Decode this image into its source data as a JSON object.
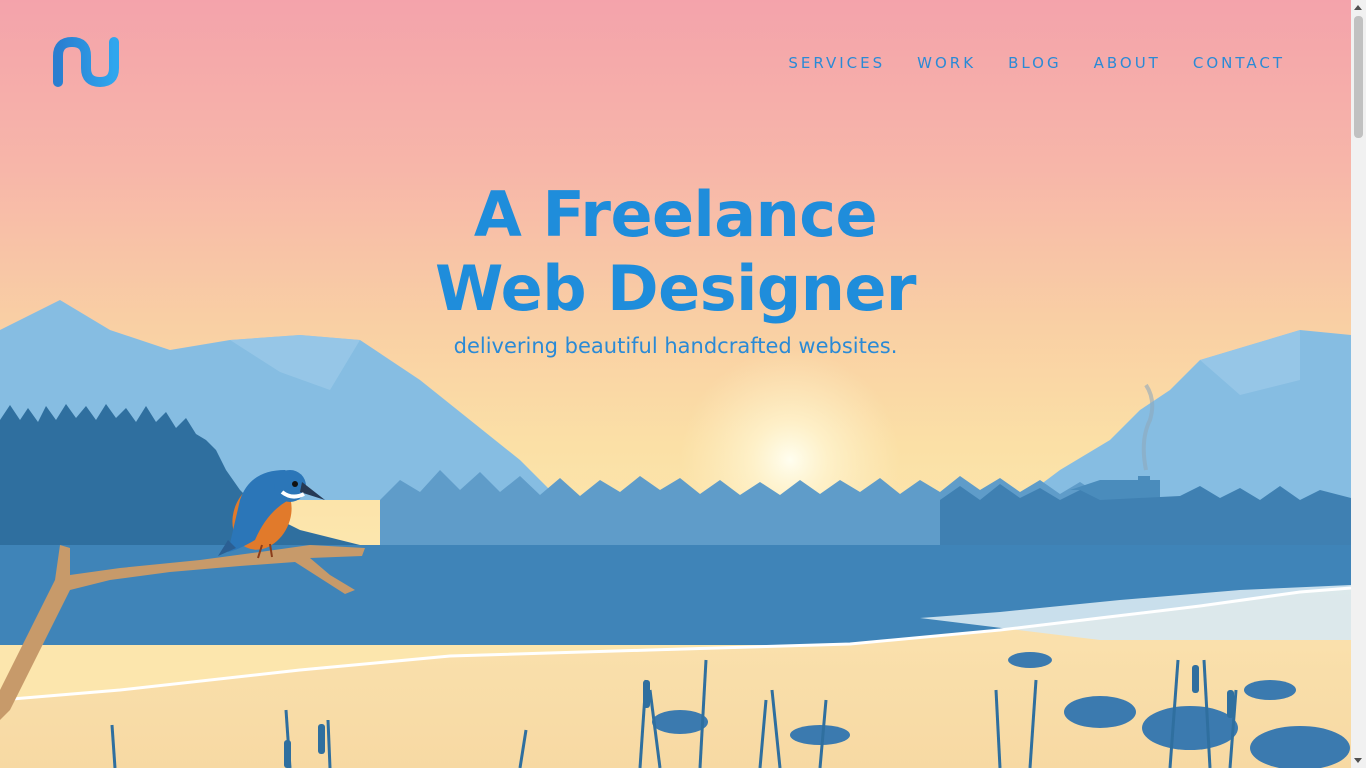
{
  "brand": {
    "logo_icon": "nu-logo-icon"
  },
  "nav": {
    "items": [
      {
        "label": "SERVICES"
      },
      {
        "label": "WORK"
      },
      {
        "label": "BLOG"
      },
      {
        "label": "ABOUT"
      },
      {
        "label": "CONTACT"
      }
    ]
  },
  "hero": {
    "title_line1": "A Freelance",
    "title_line2": "Web Designer",
    "subtitle": "delivering beautiful handcrafted websites."
  },
  "colors": {
    "accent": "#1f8ddb",
    "sky_top": "#f4a3ab",
    "sky_bottom": "#fce6ad",
    "mountain": "#7fb7dc",
    "forest": "#3a77a8",
    "water": "#3f84b8"
  }
}
